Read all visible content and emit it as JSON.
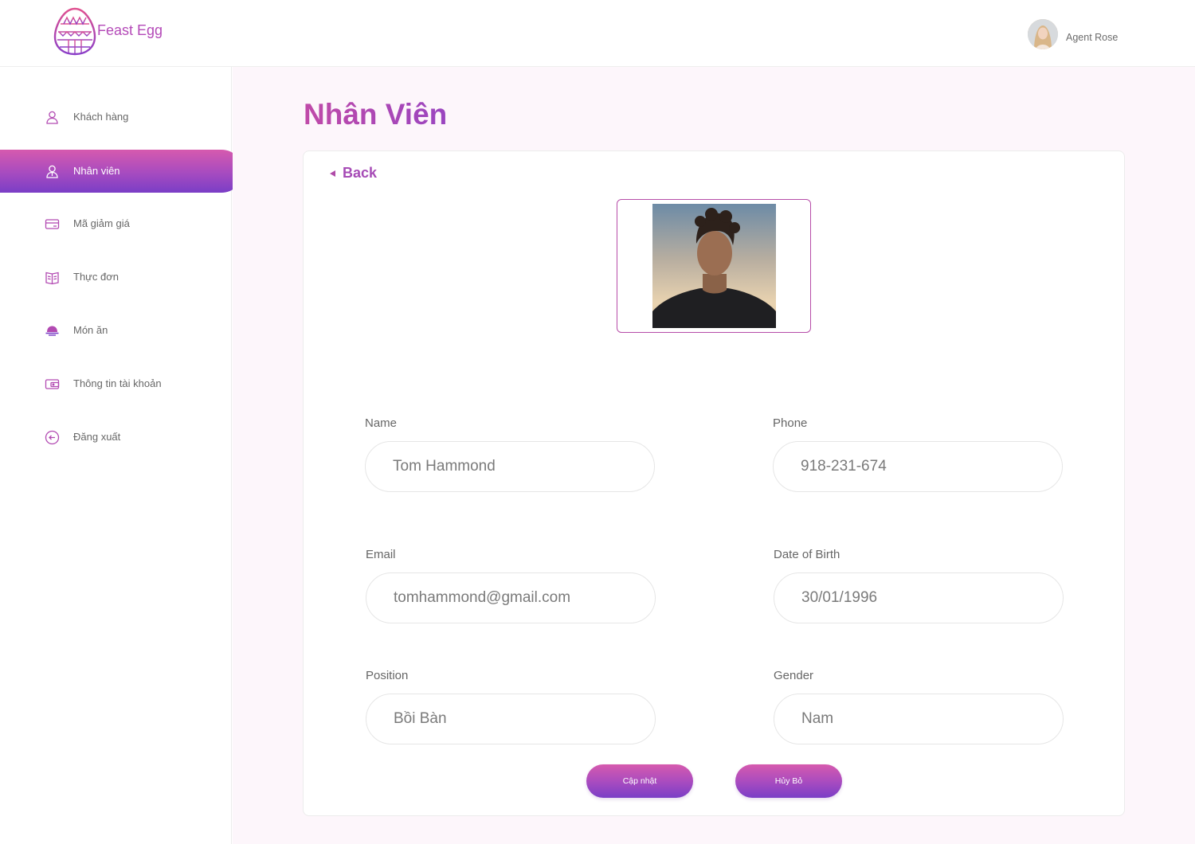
{
  "brand": {
    "name": "Feast Egg",
    "accent": "#b44ab8",
    "accent_dark": "#7a3ec6"
  },
  "user": {
    "name": "Agent Rose"
  },
  "sidebar": {
    "items": [
      {
        "label": "Khách hàng",
        "icon": "user-icon",
        "active": false
      },
      {
        "label": "Nhân viên",
        "icon": "staff-icon",
        "active": true
      },
      {
        "label": "Mã giảm giá",
        "icon": "coupon-icon",
        "active": false
      },
      {
        "label": "Thực đơn",
        "icon": "menu-book-icon",
        "active": false
      },
      {
        "label": "Món ăn",
        "icon": "dish-icon",
        "active": false
      },
      {
        "label": "Thông tin tài khoản",
        "icon": "wallet-icon",
        "active": false
      },
      {
        "label": "Đăng xuất",
        "icon": "logout-icon",
        "active": false
      }
    ]
  },
  "page": {
    "title": "Nhân Viên",
    "back_label": "Back"
  },
  "form": {
    "name": {
      "label": "Name",
      "value": "Tom Hammond"
    },
    "phone": {
      "label": "Phone",
      "value": "918-231-674"
    },
    "email": {
      "label": "Email",
      "value": "tomhammond@gmail.com"
    },
    "dob": {
      "label": "Date of Birth",
      "value": "30/01/1996"
    },
    "position": {
      "label": "Position",
      "value": "Bồi Bàn"
    },
    "gender": {
      "label": "Gender",
      "value": "Nam"
    }
  },
  "actions": {
    "update_label": "Cập nhật",
    "cancel_label": "Hủy Bỏ"
  }
}
